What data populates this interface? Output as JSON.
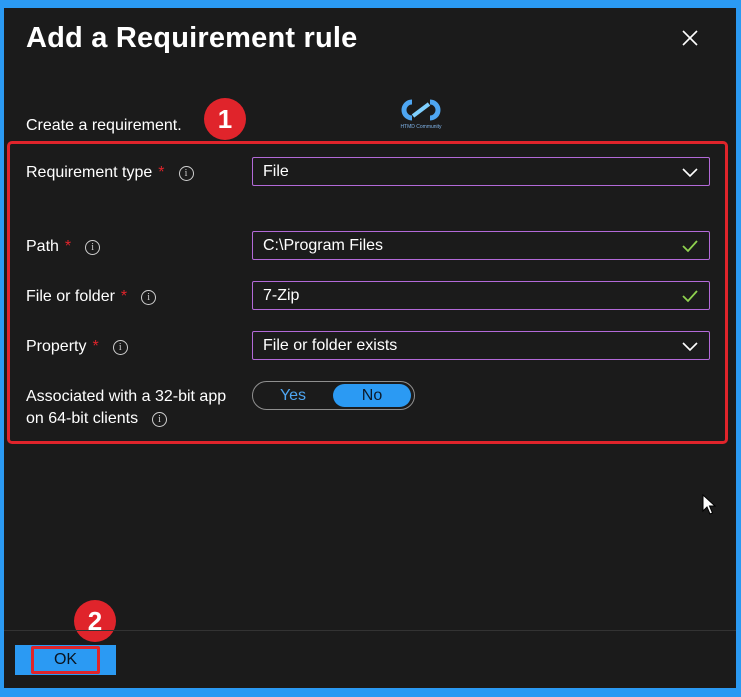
{
  "dialog": {
    "title": "Add a Requirement rule",
    "subtitle": "Create a requirement."
  },
  "annotations": {
    "badge_1": "1",
    "badge_2": "2"
  },
  "logo": {
    "text": "HTMD Community",
    "icon": "htmd-logo-icon"
  },
  "form": {
    "requirement_type": {
      "label": "Requirement type",
      "required_mark": "*",
      "value": "File"
    },
    "path": {
      "label": "Path",
      "required_mark": "*",
      "value": "C:\\Program Files"
    },
    "file_or_folder": {
      "label": "File or folder",
      "required_mark": "*",
      "value": "7-Zip"
    },
    "property": {
      "label": "Property",
      "required_mark": "*",
      "value": "File or folder exists"
    },
    "associated_32bit": {
      "label_line1": "Associated with a 32-bit app",
      "label_line2": "on 64-bit clients",
      "options": [
        "Yes",
        "No"
      ],
      "selected": "No"
    }
  },
  "footer": {
    "ok_label": "OK"
  },
  "colors": {
    "accent": "#2b9af3",
    "highlight_red": "#e0242b",
    "field_border": "#b36ad8",
    "valid_check": "#8fd14f",
    "background": "#1b1b1b"
  }
}
